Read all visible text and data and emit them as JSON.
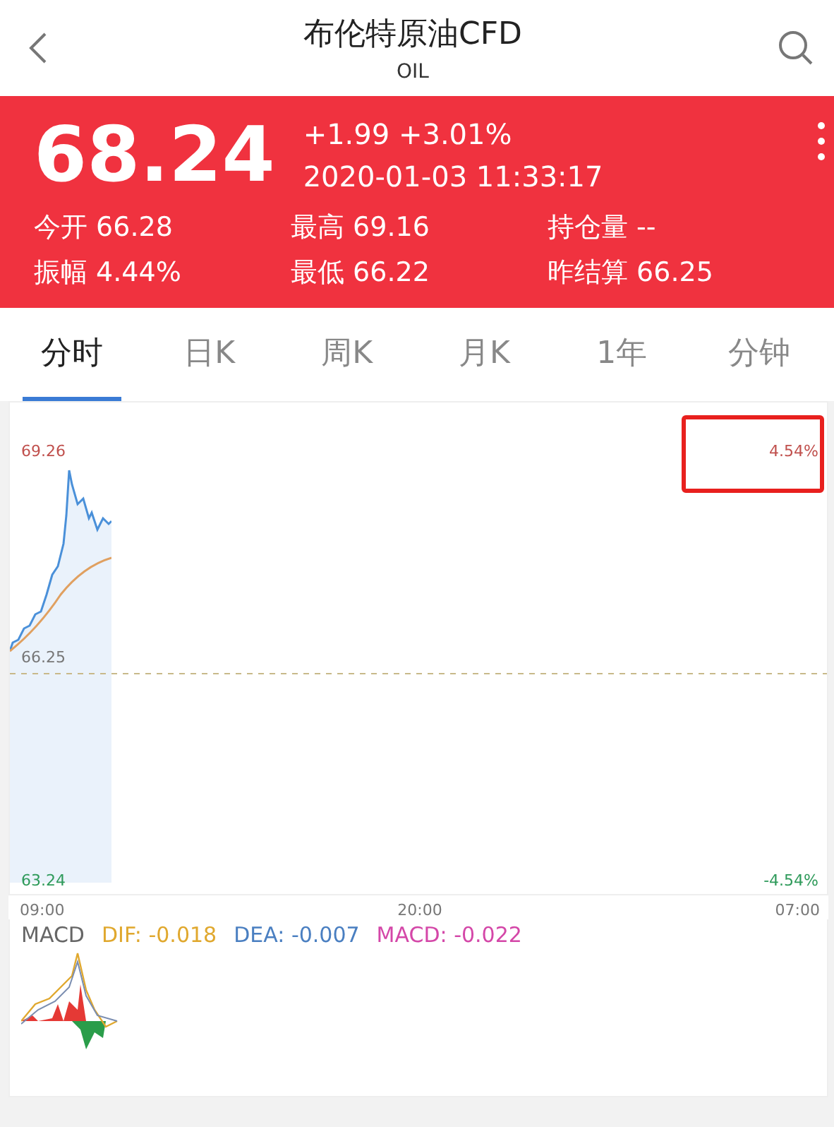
{
  "header": {
    "title": "布伦特原油CFD",
    "subtitle": "OIL"
  },
  "quote": {
    "price": "68.24",
    "change": "+1.99 +3.01%",
    "time": "2020-01-03 11:33:17",
    "stats": [
      "今开 66.28",
      "最高 69.16",
      "持仓量 --",
      "振幅 4.44%",
      "最低 66.22",
      "昨结算 66.25"
    ]
  },
  "tabs": [
    {
      "label": "分时",
      "selected": true
    },
    {
      "label": "日K",
      "selected": false
    },
    {
      "label": "周K",
      "selected": false
    },
    {
      "label": "月K",
      "selected": false
    },
    {
      "label": "1年",
      "selected": false
    },
    {
      "label": "分钟",
      "selected": false
    }
  ],
  "chart": {
    "price_high": "69.26",
    "price_mid": "66.25",
    "price_low": "63.24",
    "pct_high": "4.54%",
    "pct_low": "-4.54%",
    "highlighted": true,
    "times": [
      "09:00",
      "20:00",
      "07:00"
    ]
  },
  "macd": {
    "title": "MACD",
    "values": [
      {
        "text": "DIF: -0.018",
        "color": "#e0a82e"
      },
      {
        "text": "DEA: -0.007",
        "color": "#4a7fc1"
      },
      {
        "text": "MACD: -0.022",
        "color": "#d447a8"
      }
    ]
  }
}
